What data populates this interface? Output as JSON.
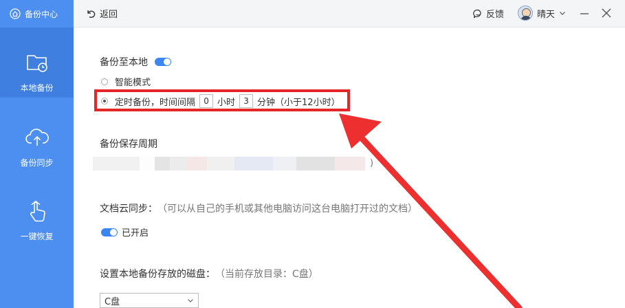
{
  "sidebar": {
    "brand": "备份中心",
    "items": [
      {
        "label": "本地备份",
        "icon": "folder-clock-icon"
      },
      {
        "label": "备份同步",
        "icon": "cloud-upload-icon"
      },
      {
        "label": "一键恢复",
        "icon": "hand-pointer-icon"
      }
    ]
  },
  "topbar": {
    "back_label": "返回",
    "feedback_label": "反馈",
    "user_name": "晴天"
  },
  "backup_local": {
    "title": "备份至本地",
    "smart_mode": "智能模式",
    "timed_prefix": "定时备份，时间间隔",
    "hours_value": "0",
    "hours_unit": "小时",
    "minutes_value": "3",
    "minutes_unit": "分钟（小于12小时）"
  },
  "retention": {
    "title": "备份保存周期",
    "trailing": ")"
  },
  "doc_sync": {
    "title": "文档云同步：",
    "desc": "（可以从自己的手机或其他电脑访问这台电脑打开过的文档）",
    "status": "已开启"
  },
  "disk": {
    "title": "设置本地备份存放的磁盘：",
    "current": "（当前存放目录：C盘）",
    "selected": "C盘"
  },
  "colors": {
    "sidebar": "#4d8ff0",
    "accent": "#3b86f0",
    "highlight": "#e42629"
  }
}
